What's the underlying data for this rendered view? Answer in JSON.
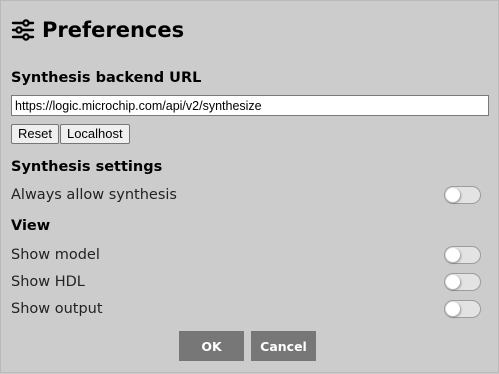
{
  "header": {
    "title": "Preferences",
    "icon": "sliders-icon"
  },
  "backend": {
    "heading": "Synthesis backend URL",
    "url_value": "https://logic.microchip.com/api/v2/synthesize",
    "reset_label": "Reset",
    "localhost_label": "Localhost"
  },
  "synthesis_settings": {
    "heading": "Synthesis settings",
    "options": [
      {
        "label": "Always allow synthesis",
        "enabled": false
      }
    ]
  },
  "view": {
    "heading": "View",
    "options": [
      {
        "label": "Show model",
        "enabled": false
      },
      {
        "label": "Show HDL",
        "enabled": false
      },
      {
        "label": "Show output",
        "enabled": false
      }
    ]
  },
  "footer": {
    "ok_label": "OK",
    "cancel_label": "Cancel"
  }
}
